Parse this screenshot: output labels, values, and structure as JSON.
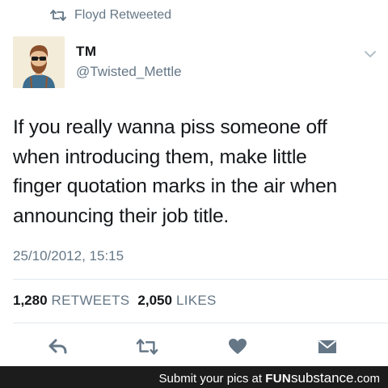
{
  "retweet_context": {
    "text": "Floyd Retweeted",
    "icon": "retweet-icon"
  },
  "author": {
    "display_name": "TM",
    "handle": "@Twisted_Mettle",
    "avatar": "bearded-man-avatar"
  },
  "tweet": {
    "lines": [
      "If you really wanna piss someone off",
      "when introducing them, make little",
      "finger quotation marks in the air when",
      "announcing their job title."
    ],
    "timestamp": "25/10/2012, 15:15"
  },
  "stats": {
    "retweets_count": "1,280",
    "retweets_label": "RETWEETS",
    "likes_count": "2,050",
    "likes_label": "LIKES"
  },
  "actions": [
    "reply-icon",
    "retweet-icon",
    "heart-icon",
    "direct-message-icon"
  ],
  "footer": {
    "prefix": "Submit your pics at",
    "brand_bold": "FUN",
    "brand_rest": "substance",
    "brand_tld": ".com"
  },
  "colors": {
    "text": "#14171a",
    "secondary": "#657786",
    "divider": "#e1e8ed",
    "footer_bg": "#1c1c1c"
  }
}
